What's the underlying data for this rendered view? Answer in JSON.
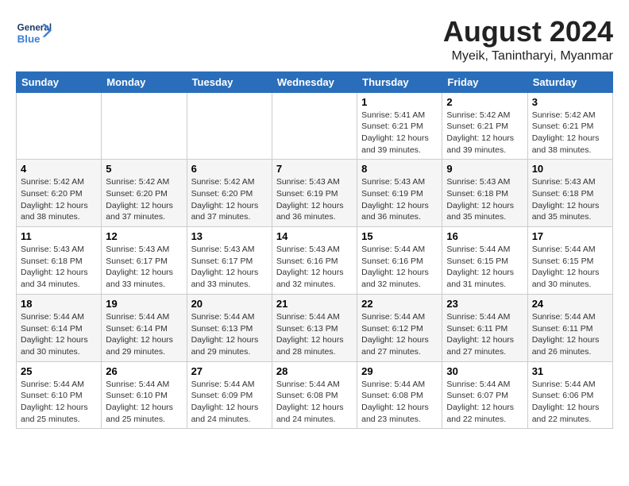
{
  "header": {
    "logo_line1": "General",
    "logo_line2": "Blue",
    "month_year": "August 2024",
    "location": "Myeik, Tanintharyi, Myanmar"
  },
  "weekdays": [
    "Sunday",
    "Monday",
    "Tuesday",
    "Wednesday",
    "Thursday",
    "Friday",
    "Saturday"
  ],
  "weeks": [
    [
      {
        "day": "",
        "info": ""
      },
      {
        "day": "",
        "info": ""
      },
      {
        "day": "",
        "info": ""
      },
      {
        "day": "",
        "info": ""
      },
      {
        "day": "1",
        "info": "Sunrise: 5:41 AM\nSunset: 6:21 PM\nDaylight: 12 hours\nand 39 minutes."
      },
      {
        "day": "2",
        "info": "Sunrise: 5:42 AM\nSunset: 6:21 PM\nDaylight: 12 hours\nand 39 minutes."
      },
      {
        "day": "3",
        "info": "Sunrise: 5:42 AM\nSunset: 6:21 PM\nDaylight: 12 hours\nand 38 minutes."
      }
    ],
    [
      {
        "day": "4",
        "info": "Sunrise: 5:42 AM\nSunset: 6:20 PM\nDaylight: 12 hours\nand 38 minutes."
      },
      {
        "day": "5",
        "info": "Sunrise: 5:42 AM\nSunset: 6:20 PM\nDaylight: 12 hours\nand 37 minutes."
      },
      {
        "day": "6",
        "info": "Sunrise: 5:42 AM\nSunset: 6:20 PM\nDaylight: 12 hours\nand 37 minutes."
      },
      {
        "day": "7",
        "info": "Sunrise: 5:43 AM\nSunset: 6:19 PM\nDaylight: 12 hours\nand 36 minutes."
      },
      {
        "day": "8",
        "info": "Sunrise: 5:43 AM\nSunset: 6:19 PM\nDaylight: 12 hours\nand 36 minutes."
      },
      {
        "day": "9",
        "info": "Sunrise: 5:43 AM\nSunset: 6:18 PM\nDaylight: 12 hours\nand 35 minutes."
      },
      {
        "day": "10",
        "info": "Sunrise: 5:43 AM\nSunset: 6:18 PM\nDaylight: 12 hours\nand 35 minutes."
      }
    ],
    [
      {
        "day": "11",
        "info": "Sunrise: 5:43 AM\nSunset: 6:18 PM\nDaylight: 12 hours\nand 34 minutes."
      },
      {
        "day": "12",
        "info": "Sunrise: 5:43 AM\nSunset: 6:17 PM\nDaylight: 12 hours\nand 33 minutes."
      },
      {
        "day": "13",
        "info": "Sunrise: 5:43 AM\nSunset: 6:17 PM\nDaylight: 12 hours\nand 33 minutes."
      },
      {
        "day": "14",
        "info": "Sunrise: 5:43 AM\nSunset: 6:16 PM\nDaylight: 12 hours\nand 32 minutes."
      },
      {
        "day": "15",
        "info": "Sunrise: 5:44 AM\nSunset: 6:16 PM\nDaylight: 12 hours\nand 32 minutes."
      },
      {
        "day": "16",
        "info": "Sunrise: 5:44 AM\nSunset: 6:15 PM\nDaylight: 12 hours\nand 31 minutes."
      },
      {
        "day": "17",
        "info": "Sunrise: 5:44 AM\nSunset: 6:15 PM\nDaylight: 12 hours\nand 30 minutes."
      }
    ],
    [
      {
        "day": "18",
        "info": "Sunrise: 5:44 AM\nSunset: 6:14 PM\nDaylight: 12 hours\nand 30 minutes."
      },
      {
        "day": "19",
        "info": "Sunrise: 5:44 AM\nSunset: 6:14 PM\nDaylight: 12 hours\nand 29 minutes."
      },
      {
        "day": "20",
        "info": "Sunrise: 5:44 AM\nSunset: 6:13 PM\nDaylight: 12 hours\nand 29 minutes."
      },
      {
        "day": "21",
        "info": "Sunrise: 5:44 AM\nSunset: 6:13 PM\nDaylight: 12 hours\nand 28 minutes."
      },
      {
        "day": "22",
        "info": "Sunrise: 5:44 AM\nSunset: 6:12 PM\nDaylight: 12 hours\nand 27 minutes."
      },
      {
        "day": "23",
        "info": "Sunrise: 5:44 AM\nSunset: 6:11 PM\nDaylight: 12 hours\nand 27 minutes."
      },
      {
        "day": "24",
        "info": "Sunrise: 5:44 AM\nSunset: 6:11 PM\nDaylight: 12 hours\nand 26 minutes."
      }
    ],
    [
      {
        "day": "25",
        "info": "Sunrise: 5:44 AM\nSunset: 6:10 PM\nDaylight: 12 hours\nand 25 minutes."
      },
      {
        "day": "26",
        "info": "Sunrise: 5:44 AM\nSunset: 6:10 PM\nDaylight: 12 hours\nand 25 minutes."
      },
      {
        "day": "27",
        "info": "Sunrise: 5:44 AM\nSunset: 6:09 PM\nDaylight: 12 hours\nand 24 minutes."
      },
      {
        "day": "28",
        "info": "Sunrise: 5:44 AM\nSunset: 6:08 PM\nDaylight: 12 hours\nand 24 minutes."
      },
      {
        "day": "29",
        "info": "Sunrise: 5:44 AM\nSunset: 6:08 PM\nDaylight: 12 hours\nand 23 minutes."
      },
      {
        "day": "30",
        "info": "Sunrise: 5:44 AM\nSunset: 6:07 PM\nDaylight: 12 hours\nand 22 minutes."
      },
      {
        "day": "31",
        "info": "Sunrise: 5:44 AM\nSunset: 6:06 PM\nDaylight: 12 hours\nand 22 minutes."
      }
    ]
  ]
}
